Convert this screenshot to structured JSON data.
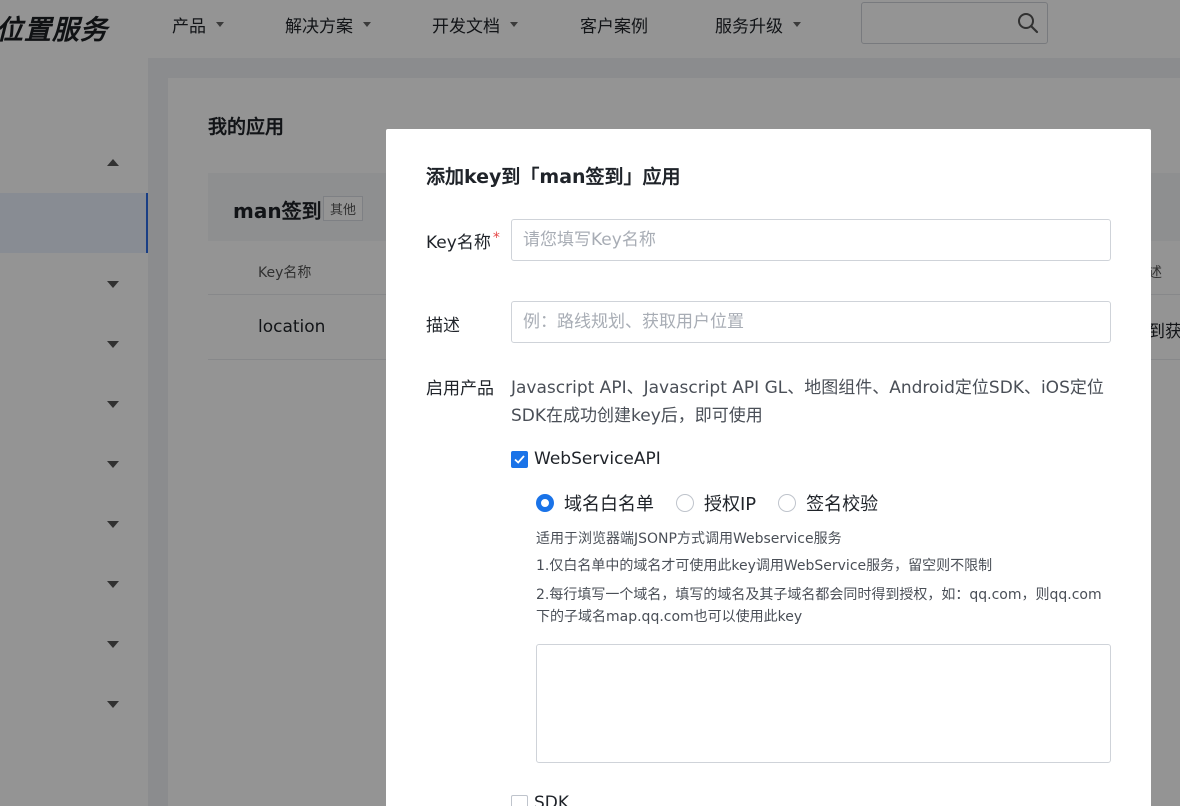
{
  "header": {
    "logo": "位置服务",
    "nav": [
      {
        "label": "产品",
        "has_caret": true
      },
      {
        "label": "解决方案",
        "has_caret": true
      },
      {
        "label": "开发文档",
        "has_caret": true
      },
      {
        "label": "客户案例",
        "has_caret": false
      },
      {
        "label": "服务升级",
        "has_caret": true
      }
    ],
    "search": {
      "placeholder": "",
      "icon": "search-icon"
    }
  },
  "main": {
    "title": "我的应用",
    "app": {
      "name": "man签到",
      "badge": "其他"
    },
    "table": {
      "columns": [
        "Key名称",
        "述"
      ],
      "rows": [
        {
          "key_name": "location",
          "edge_text": "到获"
        }
      ]
    }
  },
  "modal": {
    "title": "添加key到「man签到」应用",
    "key_name": {
      "label": "Key名称",
      "required_mark": "*",
      "placeholder": "请您填写Key名称",
      "value": ""
    },
    "description": {
      "label": "描述",
      "placeholder": "例：路线规划、获取用户位置",
      "value": ""
    },
    "products": {
      "label": "启用产品",
      "text": "Javascript API、Javascript API GL、地图组件、Android定位SDK、iOS定位SDK在成功创建key后，即可使用"
    },
    "webservice": {
      "label": "WebServiceAPI",
      "checked": true,
      "options": [
        {
          "label": "域名白名单",
          "selected": true
        },
        {
          "label": "授权IP",
          "selected": false
        },
        {
          "label": "签名校验",
          "selected": false
        }
      ],
      "hints": [
        "适用于浏览器端JSONP方式调用Webservice服务",
        "1.仅白名单中的域名才可使用此key调用WebService服务，留空则不限制",
        "2.每行填写一个域名，填写的域名及其子域名都会同时得到授权，如：qq.com，则qq.com下的子域名map.qq.com也可以使用此key"
      ],
      "textarea_value": ""
    },
    "sdk": {
      "label": "SDK",
      "checked": false
    }
  },
  "colors": {
    "accent": "#1a73e8",
    "required": "#e54545"
  }
}
